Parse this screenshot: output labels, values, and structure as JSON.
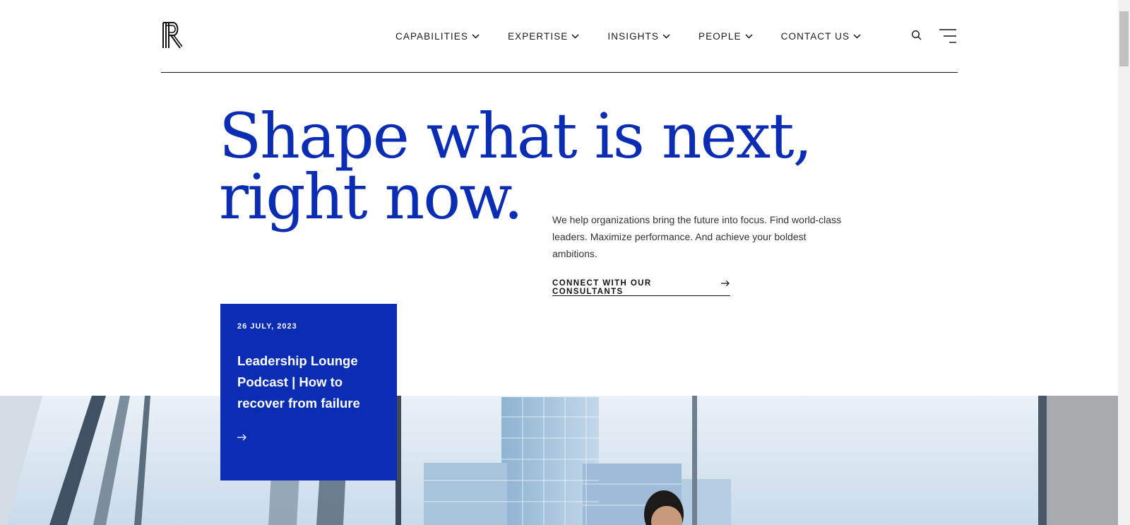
{
  "header": {
    "nav": [
      {
        "label": "CAPABILITIES"
      },
      {
        "label": "EXPERTISE"
      },
      {
        "label": "INSIGHTS"
      },
      {
        "label": "PEOPLE"
      },
      {
        "label": "CONTACT US"
      }
    ],
    "icons": {
      "logo": "r-logo-icon",
      "search": "search-icon",
      "menu": "hamburger-menu-icon",
      "chevron": "chevron-down-icon"
    }
  },
  "hero": {
    "headline_line1": "Shape what is next,",
    "headline_line2": "right now.",
    "intro": "We help organizations bring the future into focus. Find world-class leaders. Maximize performance. And achieve your boldest ambitions.",
    "cta_label": "CONNECT WITH OUR CONSULTANTS"
  },
  "card": {
    "date": "26 JULY, 2023",
    "title": "Leadership Lounge Podcast | How to recover from failure"
  },
  "colors": {
    "brand_blue": "#0a2db3",
    "text_dark": "#1a1a1a",
    "background": "#ffffff"
  }
}
